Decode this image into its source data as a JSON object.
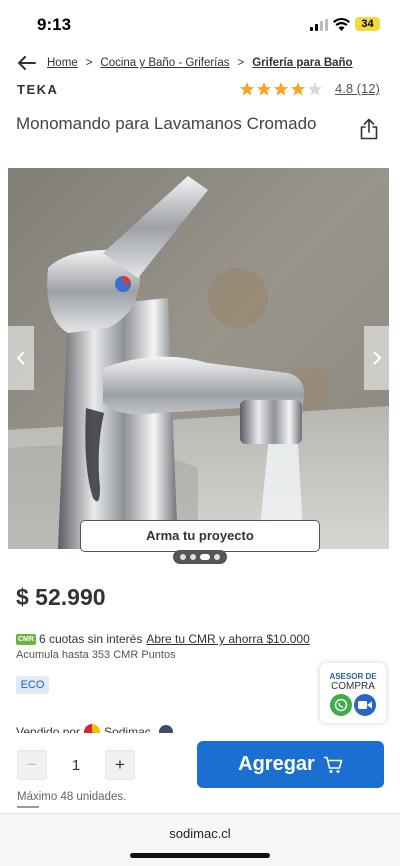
{
  "status": {
    "time": "9:13",
    "battery": "34"
  },
  "breadcrumb": {
    "items": [
      "Home",
      "Cocina y Baño - Griferías",
      "Grifería para Baño"
    ]
  },
  "product": {
    "brand": "TEKA",
    "rating_value": 4,
    "rating_max": 5,
    "rating_text": "4.8 (12)",
    "title": "Monomando para Lavamanos Cromado",
    "price": "$ 52.990"
  },
  "gallery": {
    "project_button": "Arma tu proyecto",
    "slides_total": 4,
    "slide_active": 2
  },
  "promo": {
    "badge": "CMR",
    "text": "6 cuotas sin interés",
    "link": "Abre tu CMR y ahorra $10.000",
    "points": "Acumula hasta 353 CMR Puntos",
    "eco": "ECO"
  },
  "advisor": {
    "line1": "ASESOR DE",
    "line2": "COMPRA"
  },
  "seller": {
    "text": "Vendido por",
    "name": "Sodimac"
  },
  "purchase": {
    "minus": "−",
    "quantity": "1",
    "plus": "+",
    "add_label": "Agregar",
    "max_units": "Máximo 48 unidades."
  },
  "browser": {
    "url": "sodimac.cl"
  },
  "colors": {
    "primary": "#1b6fd0",
    "star": "#f5a623",
    "cmr_green": "#6db33f"
  }
}
